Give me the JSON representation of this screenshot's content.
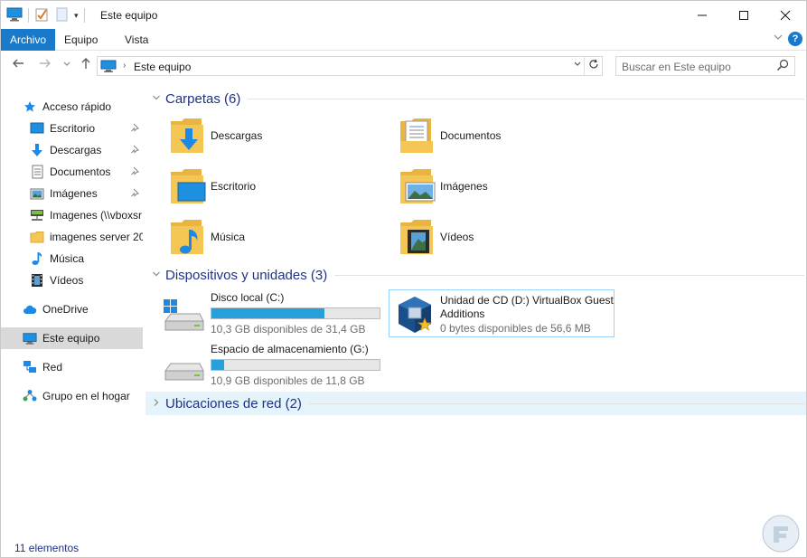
{
  "window": {
    "title": "Este equipo",
    "controls": {
      "minimize": "—",
      "maximize": "☐",
      "close": "✕"
    }
  },
  "ribbon": {
    "tabs": [
      "Archivo",
      "Equipo",
      "Vista"
    ]
  },
  "addressbar": {
    "path": "Este equipo",
    "search_placeholder": "Buscar en Este equipo"
  },
  "sidebar": {
    "quick_access": "Acceso rápido",
    "quick_items": [
      {
        "label": "Escritorio",
        "icon": "desktop-icon",
        "pinned": true
      },
      {
        "label": "Descargas",
        "icon": "download-icon",
        "pinned": true
      },
      {
        "label": "Documentos",
        "icon": "document-icon",
        "pinned": true
      },
      {
        "label": "Imágenes",
        "icon": "pictures-icon",
        "pinned": true
      },
      {
        "label": "Imagenes (\\\\vboxsr",
        "icon": "network-folder-icon",
        "pinned": false
      },
      {
        "label": "imagenes server 20",
        "icon": "folder-icon",
        "pinned": false
      },
      {
        "label": "Música",
        "icon": "music-icon",
        "pinned": false
      },
      {
        "label": "Vídeos",
        "icon": "video-icon",
        "pinned": false
      }
    ],
    "onedrive": "OneDrive",
    "this_pc": "Este equipo",
    "network": "Red",
    "homegroup": "Grupo en el hogar"
  },
  "content": {
    "folders_header": "Carpetas (6)",
    "folders": [
      {
        "label": "Descargas",
        "icon": "download-folder-icon"
      },
      {
        "label": "Documentos",
        "icon": "documents-folder-icon"
      },
      {
        "label": "Escritorio",
        "icon": "desktop-folder-icon"
      },
      {
        "label": "Imágenes",
        "icon": "pictures-folder-icon"
      },
      {
        "label": "Música",
        "icon": "music-folder-icon"
      },
      {
        "label": "Vídeos",
        "icon": "videos-folder-icon"
      }
    ],
    "devices_header": "Dispositivos y unidades (3)",
    "drives": [
      {
        "name": "Disco local (C:)",
        "free": "10,3 GB disponibles de 31,4 GB",
        "used_fraction": 0.672
      },
      {
        "name": "Espacio de almacenamiento (G:)",
        "free": "10,9 GB disponibles de 11,8 GB",
        "used_fraction": 0.076
      }
    ],
    "cd_drive": {
      "name_line1": "Unidad de CD (D:) VirtualBox Guest",
      "name_line2": "Additions",
      "free": "0 bytes disponibles de 56,6 MB"
    },
    "network_header": "Ubicaciones de red (2)"
  },
  "status": {
    "items": "11 elementos"
  },
  "colors": {
    "accent": "#1979ca",
    "header_text": "#1e3287",
    "bar_fill": "#26a0da",
    "folder": "#f4c655"
  }
}
